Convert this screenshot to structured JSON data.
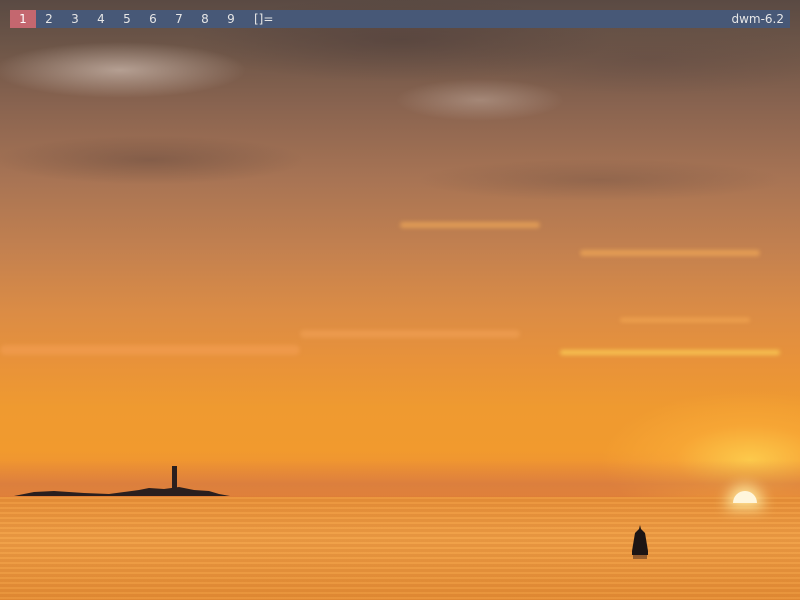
{
  "bar": {
    "tags": [
      "1",
      "2",
      "3",
      "4",
      "5",
      "6",
      "7",
      "8",
      "9"
    ],
    "selected_tag": "1",
    "layout_symbol": "[]=",
    "status_text": "dwm-6.2"
  },
  "colors": {
    "bar_background": "#475877",
    "selected_tag_background": "#c4676f",
    "bar_text": "#e6e6e6"
  },
  "wallpaper": {
    "icon": "sunset-sea-wallpaper"
  }
}
